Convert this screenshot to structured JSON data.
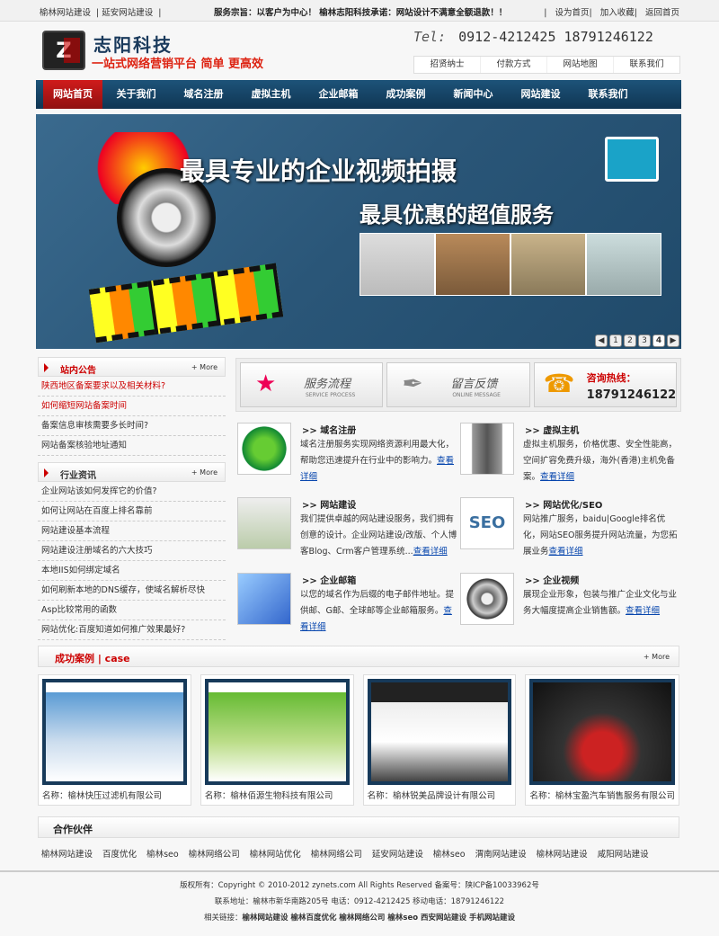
{
  "topbar": {
    "left": [
      "榆林网站建设",
      "延安网站建设"
    ],
    "middle": "服务宗旨：以客户为中心！ 榆林志阳科技承诺：网站设计不满意全额退款！！",
    "right": [
      "设为首页",
      "加入收藏",
      "返回首页"
    ]
  },
  "header": {
    "brand": "志阳科技",
    "slogan": "一站式网络营销平台 简单 更高效",
    "tel_label": "Tel:",
    "tel": "0912-4212425 18791246122",
    "links": [
      "招贤纳士",
      "付款方式",
      "网站地图",
      "联系我们"
    ]
  },
  "nav": [
    "网站首页",
    "关于我们",
    "域名注册",
    "虚拟主机",
    "企业邮箱",
    "成功案例",
    "新闻中心",
    "网站建设",
    "联系我们"
  ],
  "banner": {
    "line1": "最具专业的企业视频拍摄",
    "line2": "最具优惠的超值服务",
    "pages": [
      "1",
      "2",
      "3",
      "4"
    ]
  },
  "notice": {
    "title": "站内公告",
    "more": "+ More",
    "items": [
      "陕西地区备案要求以及相关材料?",
      "如何缩短网站备案时间",
      "备案信息审核需要多长时间?",
      "网站备案核验地址通知"
    ]
  },
  "industry": {
    "title": "行业资讯",
    "more": "+ More",
    "items": [
      "企业网站该如何发挥它的价值?",
      "如何让网站在百度上排名靠前",
      "网站建设基本流程",
      "网站建设注册域名的六大技巧",
      "本地IIS如何绑定域名",
      "如何刷新本地的DNS缓存，使域名解析尽快",
      "Asp比较常用的函数",
      "网站优化:百度知道如何推广效果最好?"
    ]
  },
  "quick": {
    "service": "服务流程",
    "service_en": "SERVICE PROCESS",
    "feedback": "留言反馈",
    "feedback_en": "ONLINE MESSAGE",
    "hotline_label": "咨询热线：",
    "hotline": "18791246122"
  },
  "services": [
    {
      "title": ">> 域名注册",
      "text": "域名注册服务实现网络资源利用最大化，帮助您迅速提升在行业中的影响力。",
      "link": "查看详细"
    },
    {
      "title": ">> 虚拟主机",
      "text": "虚拟主机服务，价格优惠、安全性能高，空间扩容免费升级，海外(香港)主机免备案。",
      "link": "查看详细"
    },
    {
      "title": ">> 网站建设",
      "text": "我们提供卓越的网站建设服务，我们拥有创意的设计。企业网站建设/改版、个人博客Blog、Crm客户管理系统...",
      "link": "查看详细"
    },
    {
      "title": ">> 网站优化/SEO",
      "text": "网站推广服务，baidu|Google排名优化，网站SEO服务提升网站流量，为您拓展业务",
      "link": "查看详细"
    },
    {
      "title": ">> 企业邮箱",
      "text": "以您的域名作为后缀的电子邮件地址。提供邮、G邮、全球邮等企业邮箱服务。",
      "link": "查看详细"
    },
    {
      "title": ">> 企业视频",
      "text": "展现企业形象，包装与推广企业文化与业务大幅度提高企业销售额。",
      "link": "查看详细"
    }
  ],
  "cases": {
    "title": "成功案例 | case",
    "more": "+ More",
    "items": [
      "名称：榆林快压过滤机有限公司",
      "名称：榆林佰源生物科技有限公司",
      "名称：榆林锐美品牌设计有限公司",
      "名称：榆林宝盈汽车销售服务有限公司"
    ]
  },
  "partners": {
    "title": "合作伙伴",
    "links": [
      "榆林网站建设",
      "百度优化",
      "榆林seo",
      "榆林网络公司",
      "榆林网站优化",
      "榆林网络公司",
      "延安网站建设",
      "榆林seo",
      "渭南网站建设",
      "榆林网站建设",
      "咸阳网站建设"
    ]
  },
  "footer": {
    "line1": "版权所有：Copyright © 2010-2012 zynets.com All Rights Reserved 备案号：陕ICP备10033962号",
    "line2": "联系地址：榆林市新华南路205号 电话：0912-4212425 移动电话：18791246122",
    "line3_label": "相关链接：",
    "line3": "榆林网站建设 榆林百度优化 榆林网络公司 榆林seo 西安网站建设 手机网站建设"
  },
  "colors": {
    "nav": "#1d5379",
    "accent": "#c00000"
  }
}
